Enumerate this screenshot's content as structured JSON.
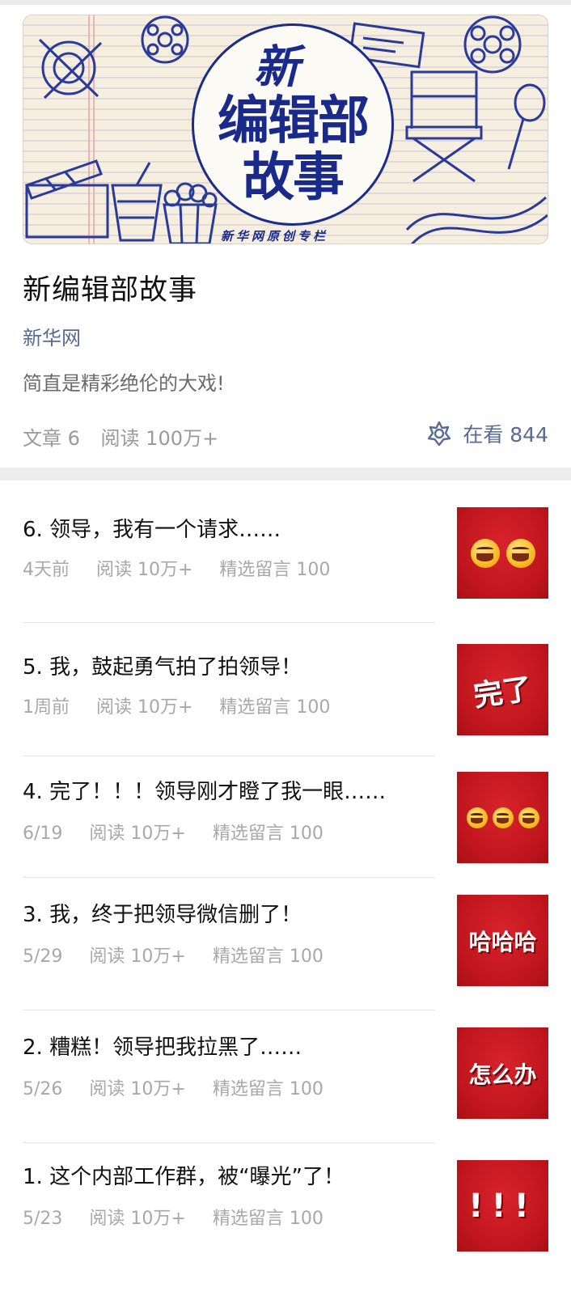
{
  "banner": {
    "title_line1": "新",
    "title_line2": "编辑部",
    "title_line3": "故事",
    "subtitle": "新华网原创专栏"
  },
  "column": {
    "title": "新编辑部故事",
    "author": "新华网",
    "description": "简直是精彩绝伦的大戏!",
    "articles_count": "文章 6",
    "reads": "阅读 100万+",
    "watching": "在看 844",
    "watching_icon": "wow-star-icon"
  },
  "articles": [
    {
      "title": "6. 领导，我有一个请求……",
      "date": "4天前",
      "reads": "阅读 10万+",
      "comments": "精选留言 100",
      "thumb_text": "",
      "thumb_icon": "laughing-emoji"
    },
    {
      "title": "5. 我，鼓起勇气拍了拍领导！",
      "date": "1周前",
      "reads": "阅读 10万+",
      "comments": "精选留言 100",
      "thumb_text": "完了",
      "thumb_icon": ""
    },
    {
      "title": "4. 完了！！！领导刚才瞪了我一眼……",
      "date": "6/19",
      "reads": "阅读 10万+",
      "comments": "精选留言 100",
      "thumb_text": "",
      "thumb_icon": "shocked-emoji"
    },
    {
      "title": "3. 我，终于把领导微信删了！",
      "date": "5/29",
      "reads": "阅读 10万+",
      "comments": "精选留言 100",
      "thumb_text": "哈哈哈",
      "thumb_icon": ""
    },
    {
      "title": "2. 糟糕！领导把我拉黑了……",
      "date": "5/26",
      "reads": "阅读 10万+",
      "comments": "精选留言 100",
      "thumb_text": "怎么办",
      "thumb_icon": ""
    },
    {
      "title": "1. 这个内部工作群，被“曝光”了！",
      "date": "5/23",
      "reads": "阅读 10万+",
      "comments": "精选留言 100",
      "thumb_text": "!!!",
      "thumb_icon": ""
    }
  ],
  "colors": {
    "link": "#576b95",
    "thumb_red": "#c7181f",
    "banner_blue": "#1a2a8a"
  }
}
